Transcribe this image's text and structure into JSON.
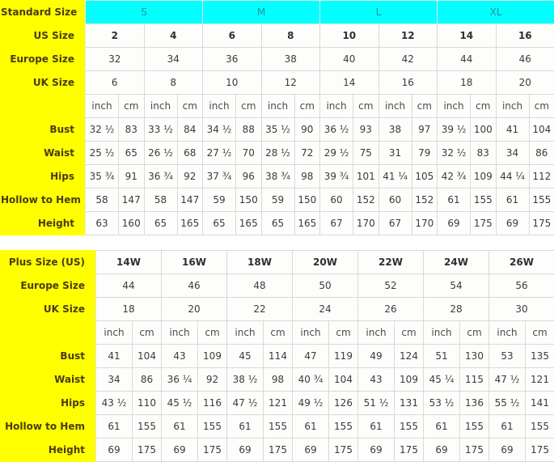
{
  "standard_table": {
    "label_column_header": "Standard Size",
    "group_row": {
      "label": "Standard Size",
      "groups": [
        "S",
        "M",
        "L",
        "XL"
      ]
    },
    "size_rows": [
      {
        "label": "US Size",
        "values": [
          "2",
          "4",
          "6",
          "8",
          "10",
          "12",
          "14",
          "16"
        ],
        "bold": true
      },
      {
        "label": "Europe Size",
        "values": [
          "32",
          "34",
          "36",
          "38",
          "40",
          "42",
          "44",
          "46"
        ],
        "bold": false
      },
      {
        "label": "UK Size",
        "values": [
          "6",
          "8",
          "10",
          "12",
          "14",
          "16",
          "18",
          "20"
        ],
        "bold": false
      }
    ],
    "unit_row": {
      "label": "",
      "units": [
        "inch",
        "cm",
        "inch",
        "cm",
        "inch",
        "cm",
        "inch",
        "cm",
        "inch",
        "cm",
        "inch",
        "cm",
        "inch",
        "cm",
        "inch",
        "cm"
      ]
    },
    "measure_rows": [
      {
        "label": "Bust",
        "values": [
          "32 ½",
          "83",
          "33 ½",
          "84",
          "34 ½",
          "88",
          "35 ½",
          "90",
          "36 ½",
          "93",
          "38",
          "97",
          "39 ½",
          "100",
          "41",
          "104"
        ]
      },
      {
        "label": "Waist",
        "values": [
          "25 ½",
          "65",
          "26 ½",
          "68",
          "27 ½",
          "70",
          "28 ½",
          "72",
          "29 ½",
          "75",
          "31",
          "79",
          "32 ½",
          "83",
          "34",
          "86"
        ]
      },
      {
        "label": "Hips",
        "values": [
          "35 ¾",
          "91",
          "36 ¾",
          "92",
          "37 ¾",
          "96",
          "38 ¾",
          "98",
          "39 ¾",
          "101",
          "41 ¼",
          "105",
          "42 ¾",
          "109",
          "44 ¼",
          "112"
        ]
      },
      {
        "label": "Hollow to Hem",
        "values": [
          "58",
          "147",
          "58",
          "147",
          "59",
          "150",
          "59",
          "150",
          "60",
          "152",
          "60",
          "152",
          "61",
          "155",
          "61",
          "155"
        ]
      },
      {
        "label": "Height",
        "values": [
          "63",
          "160",
          "65",
          "165",
          "65",
          "165",
          "65",
          "165",
          "67",
          "170",
          "67",
          "170",
          "69",
          "175",
          "69",
          "175"
        ]
      }
    ]
  },
  "plus_table": {
    "size_rows": [
      {
        "label": "Plus Size (US)",
        "values": [
          "14W",
          "16W",
          "18W",
          "20W",
          "22W",
          "24W",
          "26W"
        ],
        "bold": true
      },
      {
        "label": "Europe Size",
        "values": [
          "44",
          "46",
          "48",
          "50",
          "52",
          "54",
          "56"
        ],
        "bold": false
      },
      {
        "label": "UK Size",
        "values": [
          "18",
          "20",
          "22",
          "24",
          "26",
          "28",
          "30"
        ],
        "bold": false
      }
    ],
    "unit_row": {
      "label": "",
      "units": [
        "inch",
        "cm",
        "inch",
        "cm",
        "inch",
        "cm",
        "inch",
        "cm",
        "inch",
        "cm",
        "inch",
        "cm",
        "inch",
        "cm"
      ]
    },
    "measure_rows": [
      {
        "label": "Bust",
        "values": [
          "41",
          "104",
          "43",
          "109",
          "45",
          "114",
          "47",
          "119",
          "49",
          "124",
          "51",
          "130",
          "53",
          "135"
        ]
      },
      {
        "label": "Waist",
        "values": [
          "34",
          "86",
          "36 ¼",
          "92",
          "38 ½",
          "98",
          "40 ¾",
          "104",
          "43",
          "109",
          "45 ¼",
          "115",
          "47 ½",
          "121"
        ]
      },
      {
        "label": "Hips",
        "values": [
          "43 ½",
          "110",
          "45 ½",
          "116",
          "47 ½",
          "121",
          "49 ½",
          "126",
          "51 ½",
          "131",
          "53 ½",
          "136",
          "55 ½",
          "141"
        ]
      },
      {
        "label": "Hollow to Hem",
        "values": [
          "61",
          "155",
          "61",
          "155",
          "61",
          "155",
          "61",
          "155",
          "61",
          "155",
          "61",
          "155",
          "61",
          "155"
        ]
      },
      {
        "label": "Height",
        "values": [
          "69",
          "175",
          "69",
          "175",
          "69",
          "175",
          "69",
          "175",
          "69",
          "175",
          "69",
          "175",
          "69",
          "175"
        ]
      }
    ]
  },
  "colors": {
    "label_bg": "#ffff00",
    "group_bg": "#00ffff",
    "cell_bg": "#fdfdfb",
    "label_text": "#4a3b10",
    "group_text": "#2e8c9e",
    "border": "#d9d9d9"
  }
}
